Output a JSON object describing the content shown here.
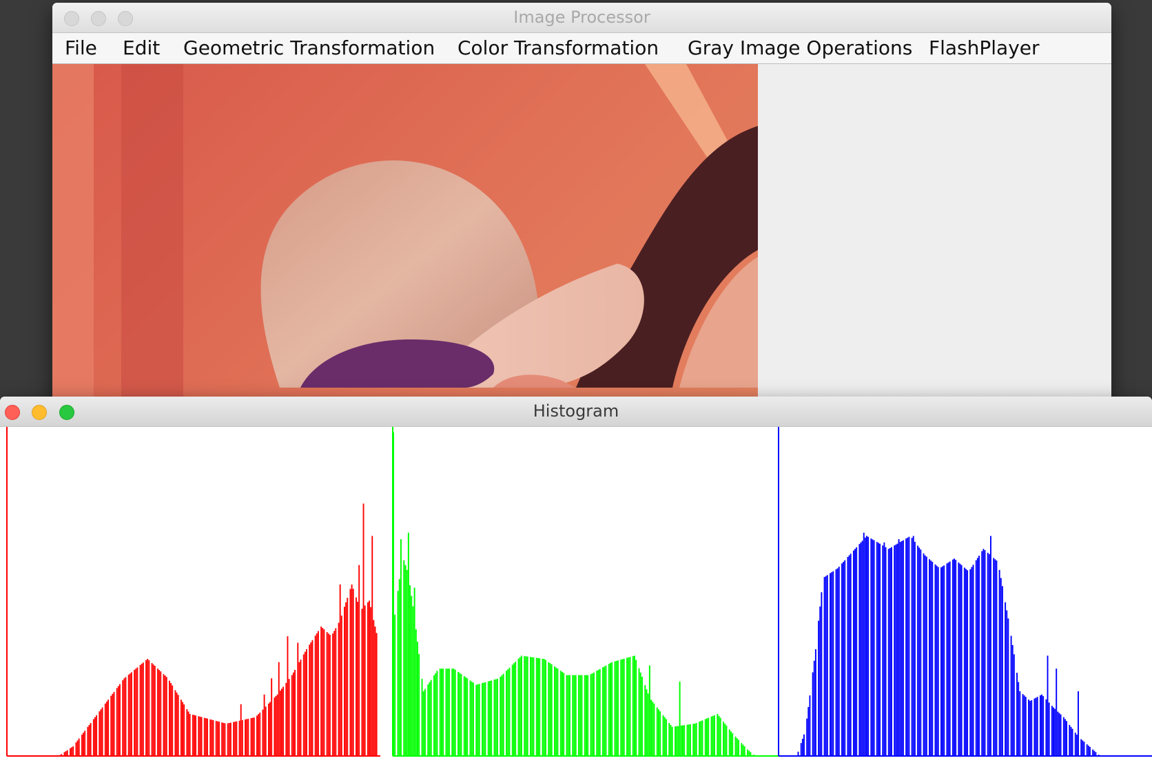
{
  "main_window": {
    "title": "Image Processor",
    "menu": [
      "File",
      "Edit",
      "Geometric Transformation",
      "Color Transformation",
      "Gray Image Operations",
      "FlashPlayer"
    ]
  },
  "histogram_window": {
    "title": "Histogram"
  },
  "colors": {
    "red_channel": "#ff0000",
    "green_channel": "#00ff00",
    "blue_channel": "#0000ff",
    "close": "#fe5f57",
    "minimize": "#febc2e",
    "zoom": "#28c840"
  },
  "icons": {
    "close": "close-icon",
    "minimize": "minimize-icon",
    "zoom": "zoom-icon"
  },
  "chart_data": [
    {
      "type": "bar",
      "channel": "red",
      "x_range": [
        0,
        255
      ],
      "peaks": [
        {
          "x": 0,
          "h": 0.0
        },
        {
          "x": 35,
          "h": 0.0
        },
        {
          "x": 45,
          "h": 0.03
        },
        {
          "x": 60,
          "h": 0.12
        },
        {
          "x": 80,
          "h": 0.24
        },
        {
          "x": 96,
          "h": 0.3
        },
        {
          "x": 110,
          "h": 0.24
        },
        {
          "x": 125,
          "h": 0.13
        },
        {
          "x": 150,
          "h": 0.1
        },
        {
          "x": 170,
          "h": 0.12
        },
        {
          "x": 185,
          "h": 0.19
        },
        {
          "x": 195,
          "h": 0.25
        },
        {
          "x": 205,
          "h": 0.33
        },
        {
          "x": 215,
          "h": 0.4
        },
        {
          "x": 222,
          "h": 0.37
        },
        {
          "x": 228,
          "h": 0.42
        },
        {
          "x": 236,
          "h": 0.53
        },
        {
          "x": 242,
          "h": 0.45
        },
        {
          "x": 248,
          "h": 0.48
        },
        {
          "x": 254,
          "h": 0.36
        },
        {
          "x": 255,
          "h": 0.0
        }
      ],
      "spikes": [
        {
          "x": 160,
          "h": 0.16
        },
        {
          "x": 176,
          "h": 0.19
        },
        {
          "x": 181,
          "h": 0.24
        },
        {
          "x": 186,
          "h": 0.29
        },
        {
          "x": 192,
          "h": 0.37
        },
        {
          "x": 199,
          "h": 0.35
        },
        {
          "x": 228,
          "h": 0.53
        },
        {
          "x": 241,
          "h": 0.59
        },
        {
          "x": 244,
          "h": 0.78
        },
        {
          "x": 250,
          "h": 0.68
        }
      ]
    },
    {
      "type": "bar",
      "channel": "green",
      "x_range": [
        0,
        255
      ],
      "peaks": [
        {
          "x": 0,
          "h": 0.4
        },
        {
          "x": 6,
          "h": 0.62
        },
        {
          "x": 10,
          "h": 0.56
        },
        {
          "x": 14,
          "h": 0.43
        },
        {
          "x": 20,
          "h": 0.2
        },
        {
          "x": 30,
          "h": 0.27
        },
        {
          "x": 40,
          "h": 0.27
        },
        {
          "x": 55,
          "h": 0.22
        },
        {
          "x": 70,
          "h": 0.24
        },
        {
          "x": 85,
          "h": 0.31
        },
        {
          "x": 100,
          "h": 0.3
        },
        {
          "x": 115,
          "h": 0.25
        },
        {
          "x": 130,
          "h": 0.25
        },
        {
          "x": 145,
          "h": 0.29
        },
        {
          "x": 160,
          "h": 0.31
        },
        {
          "x": 170,
          "h": 0.18
        },
        {
          "x": 185,
          "h": 0.09
        },
        {
          "x": 200,
          "h": 0.1
        },
        {
          "x": 215,
          "h": 0.13
        },
        {
          "x": 225,
          "h": 0.07
        },
        {
          "x": 235,
          "h": 0.02
        },
        {
          "x": 240,
          "h": 0.0
        },
        {
          "x": 255,
          "h": 0.0
        }
      ],
      "spikes": [
        {
          "x": 0,
          "h": 1.0
        },
        {
          "x": 5,
          "h": 0.67
        },
        {
          "x": 10,
          "h": 0.69
        },
        {
          "x": 14,
          "h": 0.52
        },
        {
          "x": 170,
          "h": 0.28
        },
        {
          "x": 190,
          "h": 0.23
        }
      ]
    },
    {
      "type": "bar",
      "channel": "blue",
      "x_range": [
        0,
        255
      ],
      "peaks": [
        {
          "x": 0,
          "h": 0.0
        },
        {
          "x": 12,
          "h": 0.0
        },
        {
          "x": 18,
          "h": 0.08
        },
        {
          "x": 25,
          "h": 0.33
        },
        {
          "x": 30,
          "h": 0.55
        },
        {
          "x": 40,
          "h": 0.58
        },
        {
          "x": 50,
          "h": 0.63
        },
        {
          "x": 60,
          "h": 0.68
        },
        {
          "x": 75,
          "h": 0.64
        },
        {
          "x": 90,
          "h": 0.68
        },
        {
          "x": 100,
          "h": 0.62
        },
        {
          "x": 110,
          "h": 0.58
        },
        {
          "x": 120,
          "h": 0.61
        },
        {
          "x": 130,
          "h": 0.57
        },
        {
          "x": 140,
          "h": 0.64
        },
        {
          "x": 150,
          "h": 0.6
        },
        {
          "x": 158,
          "h": 0.4
        },
        {
          "x": 165,
          "h": 0.2
        },
        {
          "x": 172,
          "h": 0.17
        },
        {
          "x": 180,
          "h": 0.19
        },
        {
          "x": 188,
          "h": 0.15
        },
        {
          "x": 195,
          "h": 0.12
        },
        {
          "x": 205,
          "h": 0.06
        },
        {
          "x": 215,
          "h": 0.02
        },
        {
          "x": 220,
          "h": 0.0
        },
        {
          "x": 255,
          "h": 0.0
        }
      ],
      "spikes": [
        {
          "x": 58,
          "h": 0.69
        },
        {
          "x": 72,
          "h": 0.66
        },
        {
          "x": 82,
          "h": 0.67
        },
        {
          "x": 92,
          "h": 0.68
        },
        {
          "x": 145,
          "h": 0.68
        },
        {
          "x": 184,
          "h": 0.31
        },
        {
          "x": 190,
          "h": 0.27
        },
        {
          "x": 205,
          "h": 0.2
        }
      ]
    }
  ]
}
